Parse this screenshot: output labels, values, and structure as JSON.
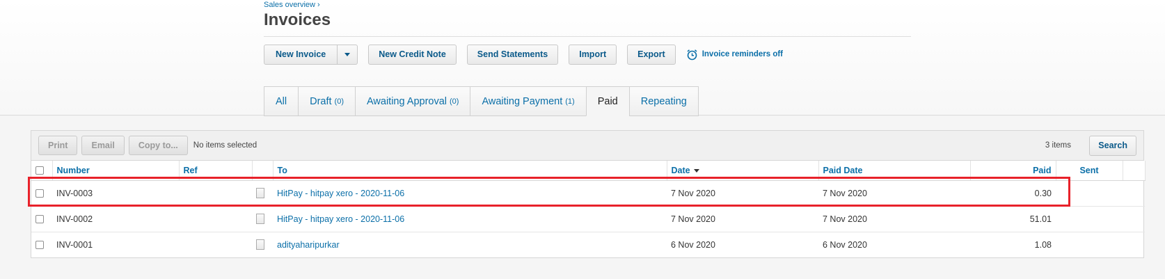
{
  "header": {
    "breadcrumb": "Sales overview ›",
    "title": "Invoices"
  },
  "toolbar": {
    "new_invoice": "New Invoice",
    "new_credit_note": "New Credit Note",
    "send_statements": "Send Statements",
    "import": "Import",
    "export": "Export",
    "reminders": "Invoice reminders off"
  },
  "tabs": [
    {
      "label": "All",
      "count": ""
    },
    {
      "label": "Draft",
      "count": "(0)"
    },
    {
      "label": "Awaiting Approval",
      "count": "(0)"
    },
    {
      "label": "Awaiting Payment",
      "count": "(1)"
    },
    {
      "label": "Paid",
      "count": ""
    },
    {
      "label": "Repeating",
      "count": ""
    }
  ],
  "active_tab": "Paid",
  "list_toolbar": {
    "print": "Print",
    "email": "Email",
    "copy_to": "Copy to...",
    "selection_status": "No items selected",
    "item_count": "3 items",
    "search": "Search"
  },
  "table": {
    "columns": {
      "number": "Number",
      "ref": "Ref",
      "to": "To",
      "date": "Date",
      "paid_date": "Paid Date",
      "paid": "Paid",
      "sent": "Sent"
    },
    "rows": [
      {
        "number": "INV-0003",
        "ref": "",
        "to": "HitPay - hitpay xero - 2020-11-06",
        "date": "7 Nov 2020",
        "paid_date": "7 Nov 2020",
        "paid": "0.30",
        "sent": ""
      },
      {
        "number": "INV-0002",
        "ref": "",
        "to": "HitPay - hitpay xero - 2020-11-06",
        "date": "7 Nov 2020",
        "paid_date": "7 Nov 2020",
        "paid": "51.01",
        "sent": ""
      },
      {
        "number": "INV-0001",
        "ref": "",
        "to": "adityaharipurkar",
        "date": "6 Nov 2020",
        "paid_date": "6 Nov 2020",
        "paid": "1.08",
        "sent": ""
      }
    ]
  },
  "colors": {
    "link": "#0b6fa8",
    "highlight": "#e8212a"
  },
  "icons": {
    "reminder": "alarm-clock-icon",
    "row": "document-icon"
  }
}
